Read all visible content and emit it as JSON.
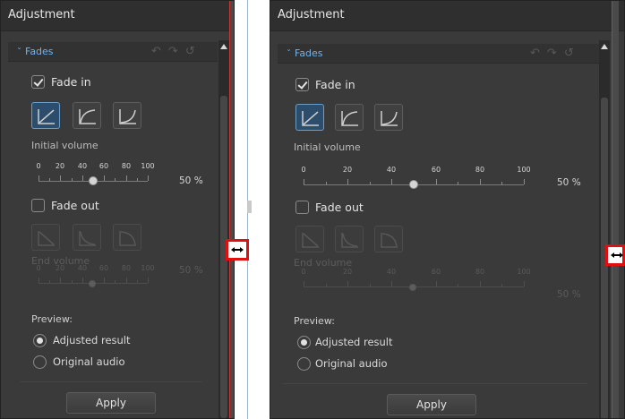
{
  "panel_title": "Adjustment",
  "section_title": "Fades",
  "fade_in": {
    "label": "Fade in",
    "checked": true
  },
  "initial_volume": {
    "label": "Initial volume",
    "ticks": [
      "0",
      "20",
      "40",
      "60",
      "80",
      "100"
    ],
    "value": 50,
    "percent_text": "50 %"
  },
  "fade_out": {
    "label": "Fade out",
    "checked": false
  },
  "end_volume": {
    "label": "End volume",
    "ticks": [
      "0",
      "20",
      "40",
      "60",
      "80",
      "100"
    ],
    "value": 50,
    "percent_text": "50 %"
  },
  "preview": {
    "label": "Preview:",
    "options": [
      {
        "label": "Adjusted result",
        "selected": true
      },
      {
        "label": "Original audio",
        "selected": false
      }
    ]
  },
  "apply_label": "Apply",
  "colors": {
    "accent": "#6fb3ec",
    "panel_bg": "#3a3a3a",
    "marker_red": "#e01010"
  }
}
